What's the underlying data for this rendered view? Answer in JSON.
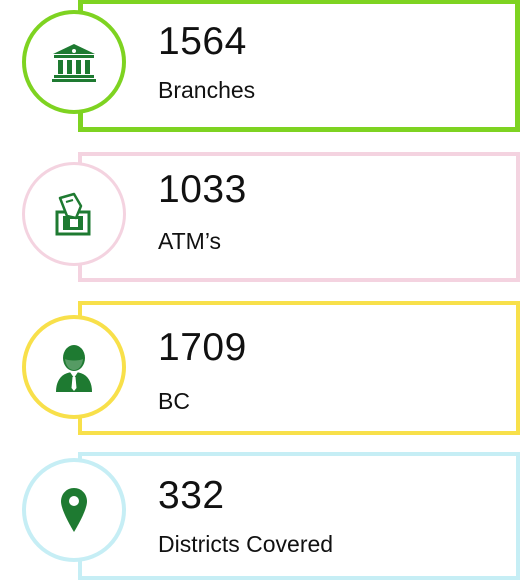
{
  "stats": [
    {
      "value": "1564",
      "label": "Branches",
      "icon": "bank-icon",
      "accent": "#7ed321"
    },
    {
      "value": "1033",
      "label": "ATM’s",
      "icon": "atm-card-icon",
      "accent": "#f4d3e0"
    },
    {
      "value": "1709",
      "label": "BC",
      "icon": "person-icon",
      "accent": "#f8e04a"
    },
    {
      "value": "332",
      "label": "Districts Covered",
      "icon": "map-pin-icon",
      "accent": "#c6eef5"
    }
  ],
  "colors": {
    "icon_green": "#1e7a31"
  }
}
